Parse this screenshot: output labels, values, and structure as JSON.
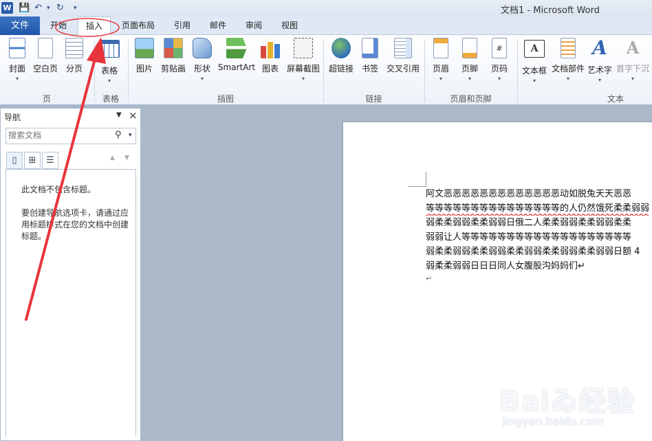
{
  "titlebar": {
    "logo": "W",
    "save": "💾",
    "undo": "↶",
    "redo": "↻",
    "more": "▾",
    "title": "文档1 - Microsoft Word"
  },
  "tabs": {
    "file": "文件",
    "home": "开始",
    "insert": "插入",
    "layout": "页面布局",
    "references": "引用",
    "mailings": "邮件",
    "review": "审阅",
    "view": "视图"
  },
  "ribbon": {
    "cover": "封面",
    "blank": "空白页",
    "pagebreak": "分页",
    "table": "表格",
    "picture": "图片",
    "clipart": "剪贴画",
    "shapes": "形状",
    "smartart": "SmartArt",
    "chart": "图表",
    "screenshot": "屏幕截图",
    "hyperlink": "超链接",
    "bookmark": "书签",
    "crossref": "交叉引用",
    "header": "页眉",
    "footer": "页脚",
    "pagenum": "页码",
    "textbox": "文本框",
    "quickparts": "文档部件",
    "wordart": "艺术字",
    "dropcap": "首字下沉",
    "groups": {
      "pages": "页",
      "tables": "表格",
      "illustrations": "插图",
      "links": "链接",
      "headerfooter": "页眉和页脚",
      "text": "文本"
    }
  },
  "nav": {
    "title": "导航",
    "search_placeholder": "搜索文档",
    "msg1": "此文档不包含标题。",
    "msg2": "要创建导航选项卡，请通过应用标题样式在您的文档中创建标题。"
  },
  "doc": {
    "lines": [
      "阿文恶恶恶恶恶恶恶恶恶恶恶恶恶动如脱兔天天恶恶",
      "等等等等等等等等等等等等等等等的人仍然饿死柔柔弱弱",
      "弱柔柔弱弱柔柔弱弱日俄二人柔柔弱弱柔柔弱弱柔柔",
      "弱弱让人等等等等等等等等等等等等等等等等等等等",
      "弱柔柔弱弱柔柔弱弱柔柔弱弱柔柔弱弱柔柔弱弱日额 4",
      "弱柔柔弱弱日日日同人女腹股沟妈妈们↵"
    ],
    "para_mark": "↵"
  },
  "watermark": {
    "main": "Baiゐ经验",
    "sub": "jingyan.baidu.com"
  },
  "colors": {
    "accent": "#1f56a8",
    "annotation": "#e8343b"
  }
}
